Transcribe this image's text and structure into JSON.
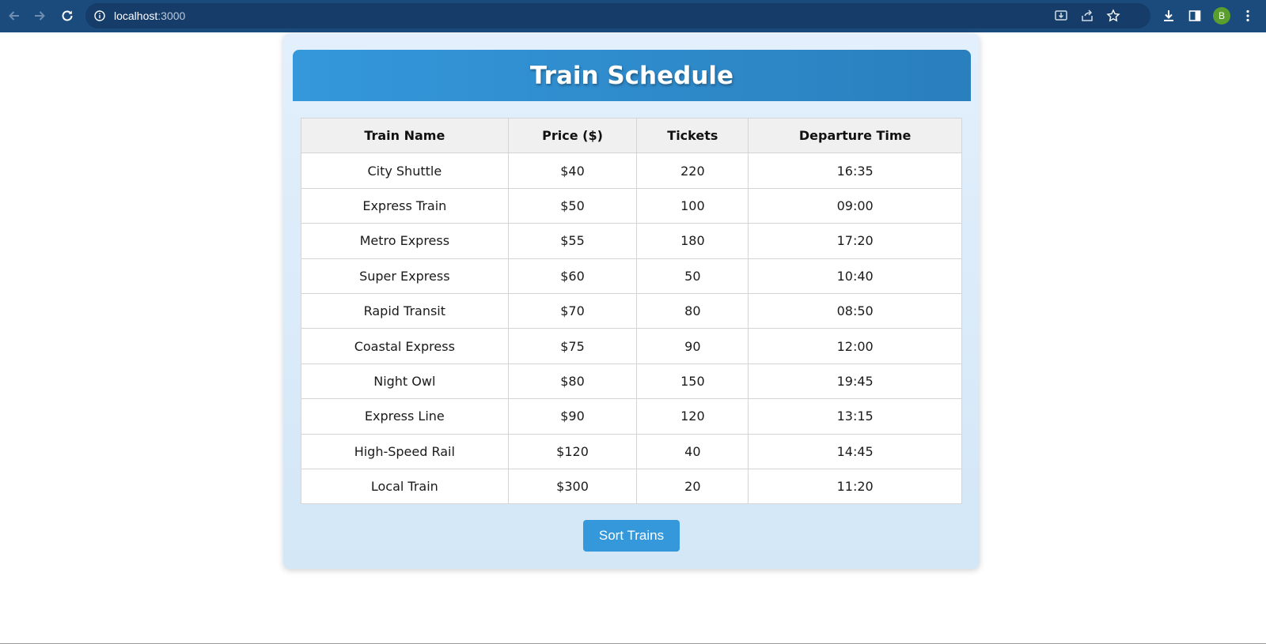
{
  "browser": {
    "url_host": "localhost",
    "url_port": ":3000",
    "avatar_letter": "B"
  },
  "page": {
    "title": "Train Schedule",
    "sort_button_label": "Sort Trains"
  },
  "table": {
    "headers": [
      "Train Name",
      "Price ($)",
      "Tickets",
      "Departure Time"
    ],
    "rows": [
      [
        "City Shuttle",
        "$40",
        "220",
        "16:35"
      ],
      [
        "Express Train",
        "$50",
        "100",
        "09:00"
      ],
      [
        "Metro Express",
        "$55",
        "180",
        "17:20"
      ],
      [
        "Super Express",
        "$60",
        "50",
        "10:40"
      ],
      [
        "Rapid Transit",
        "$70",
        "80",
        "08:50"
      ],
      [
        "Coastal Express",
        "$75",
        "90",
        "12:00"
      ],
      [
        "Night Owl",
        "$80",
        "150",
        "19:45"
      ],
      [
        "Express Line",
        "$90",
        "120",
        "13:15"
      ],
      [
        "High-Speed Rail",
        "$120",
        "40",
        "14:45"
      ],
      [
        "Local Train",
        "$300",
        "20",
        "11:20"
      ]
    ]
  },
  "icons": {
    "back": "arrow-left-icon",
    "forward": "arrow-right-icon",
    "reload": "reload-icon",
    "site_info": "info-icon",
    "install": "install-app-icon",
    "share": "share-icon",
    "bookmark": "star-icon",
    "downloads": "download-icon",
    "side_panel": "side-panel-icon",
    "menu": "kebab-menu-icon"
  },
  "colors": {
    "browser_bar": "#1b4a7c",
    "title_bar": "#3498db",
    "sort_button": "#3498db",
    "avatar": "#5a9f2e"
  }
}
